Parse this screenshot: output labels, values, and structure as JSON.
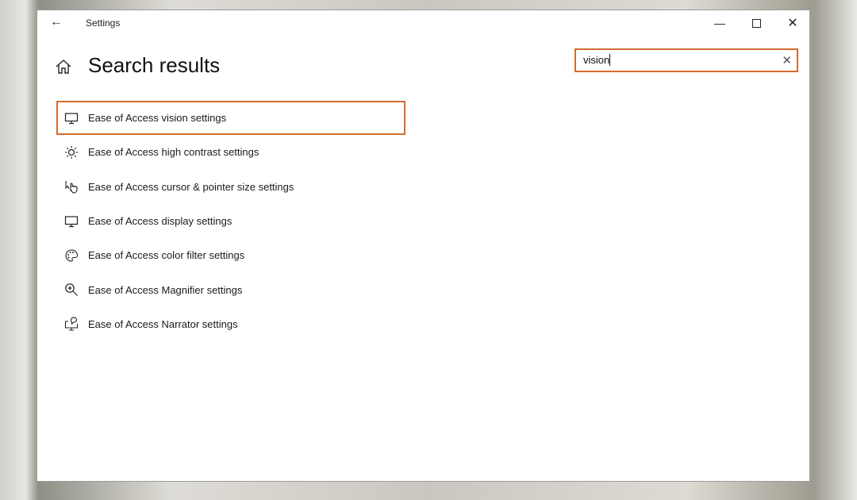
{
  "window": {
    "title": "Settings",
    "minimize_icon": "minimize-icon",
    "maximize_icon": "maximize-icon",
    "close_icon": "close-icon"
  },
  "header": {
    "title": "Search results"
  },
  "search": {
    "value": "vision"
  },
  "accent": "#d66a2e",
  "results": [
    {
      "label": "Ease of Access vision settings",
      "icon": "monitor-icon",
      "selected": true
    },
    {
      "label": "Ease of Access high contrast settings",
      "icon": "brightness-icon"
    },
    {
      "label": "Ease of Access cursor & pointer size settings",
      "icon": "pointer-icon"
    },
    {
      "label": "Ease of Access display settings",
      "icon": "monitor-icon"
    },
    {
      "label": "Ease of Access color filter settings",
      "icon": "palette-icon"
    },
    {
      "label": "Ease of Access Magnifier settings",
      "icon": "magnifier-icon"
    },
    {
      "label": "Ease of Access Narrator settings",
      "icon": "narrator-icon"
    }
  ]
}
